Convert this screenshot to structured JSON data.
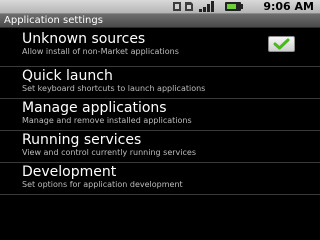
{
  "status_bar": {
    "time": "9:06 AM",
    "icons": [
      "usb-debug-icon",
      "sd-card-icon",
      "signal-icon",
      "battery-icon"
    ]
  },
  "title_bar": {
    "title": "Application settings"
  },
  "settings": [
    {
      "title": "Unknown sources",
      "summary": "Allow install of non-Market applications",
      "checkbox_checked": true
    },
    {
      "title": "Quick launch",
      "summary": "Set keyboard shortcuts to launch applications"
    },
    {
      "title": "Manage applications",
      "summary": "Manage and remove installed applications"
    },
    {
      "title": "Running services",
      "summary": "View and control currently running services"
    },
    {
      "title": "Development",
      "summary": "Set options for application development"
    }
  ],
  "colors": {
    "background": "#000000",
    "title_text": "#ffffff",
    "summary_text": "#bdbdbd",
    "check_green": "#4ab81e"
  }
}
